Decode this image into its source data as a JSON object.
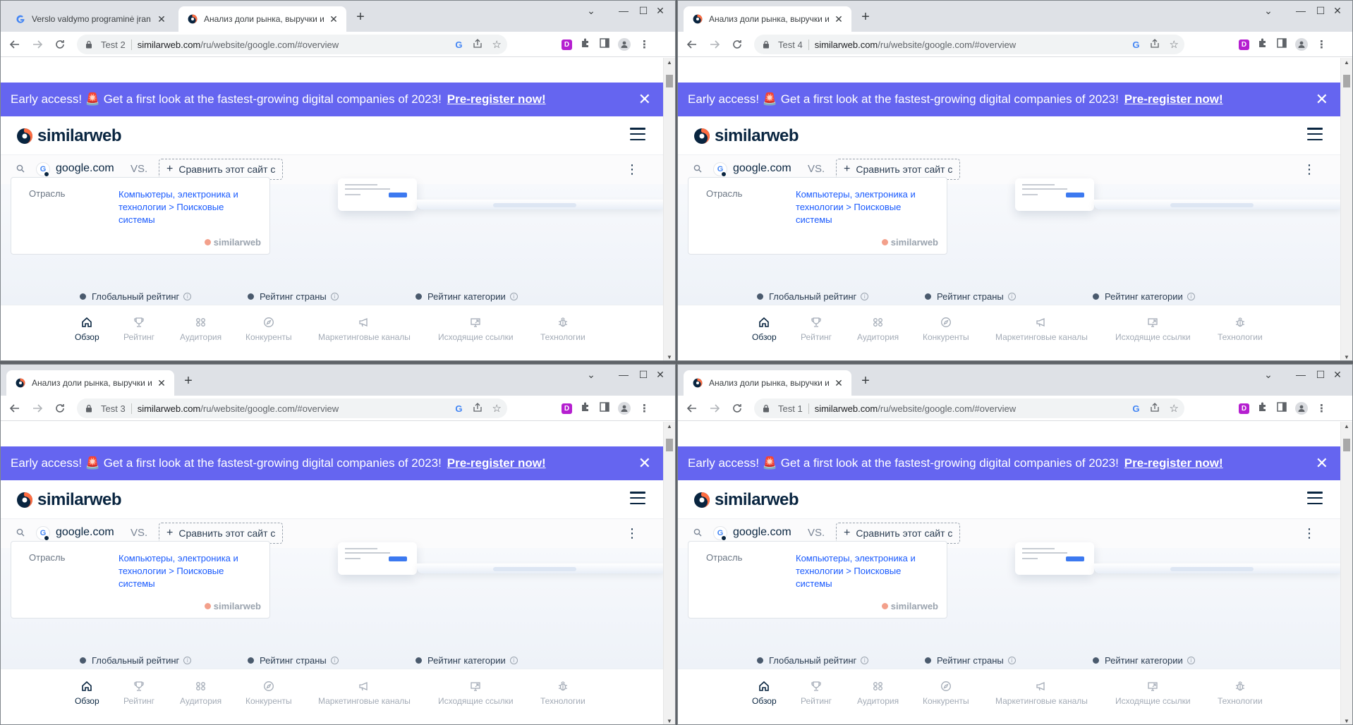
{
  "windows": [
    {
      "tabs": [
        {
          "label": "Verslo valdymo programinė įran",
          "favicon": "google-icon",
          "active": false
        },
        {
          "label": "Анализ доли рынка, выручки и",
          "favicon": "similarweb-icon",
          "active": true
        }
      ],
      "profile": "Test 2",
      "url_domain": "similarweb.com",
      "url_path": "/ru/website/google.com/#overview"
    },
    {
      "tabs": [
        {
          "label": "Анализ доли рынка, выручки и",
          "favicon": "similarweb-icon",
          "active": true
        }
      ],
      "profile": "Test 4",
      "url_domain": "similarweb.com",
      "url_path": "/ru/website/google.com/#overview"
    },
    {
      "tabs": [
        {
          "label": "Анализ доли рынка, выручки и",
          "favicon": "similarweb-icon",
          "active": true
        }
      ],
      "profile": "Test 3",
      "url_domain": "similarweb.com",
      "url_path": "/ru/website/google.com/#overview"
    },
    {
      "tabs": [
        {
          "label": "Анализ доли рынка, выручки и",
          "favicon": "similarweb-icon",
          "active": true
        }
      ],
      "profile": "Test 1",
      "url_domain": "similarweb.com",
      "url_path": "/ru/website/google.com/#overview"
    }
  ],
  "page": {
    "banner": {
      "text": "Early access! 🚨 Get a first look at the fastest-growing digital companies of 2023!",
      "cta": "Pre-register now!",
      "close": "✕"
    },
    "logo": "similarweb",
    "search": {
      "site": "google.com",
      "site_icon_letter": "G",
      "vs": "VS.",
      "compare_label": "Сравнить этот сайт с"
    },
    "industry": {
      "label": "Отрасль",
      "value": "Компьютеры, электроника и технологии > Поисковые системы"
    },
    "watermark": "similarweb",
    "ranks": [
      "Глобальный рейтинг",
      "Рейтинг страны",
      "Рейтинг категории"
    ],
    "nav": [
      {
        "label": "Обзор",
        "icon": "home-icon",
        "active": true
      },
      {
        "label": "Рейтинг",
        "icon": "trophy-icon",
        "active": false
      },
      {
        "label": "Аудитория",
        "icon": "audience-icon",
        "active": false
      },
      {
        "label": "Конкуренты",
        "icon": "compass-icon",
        "active": false
      },
      {
        "label": "Маркетинговые каналы",
        "icon": "megaphone-icon",
        "active": false
      },
      {
        "label": "Исходящие ссылки",
        "icon": "outgoing-links-icon",
        "active": false
      },
      {
        "label": "Технологии",
        "icon": "bug-icon",
        "active": false
      }
    ]
  },
  "colors": {
    "banner": "#6565f0",
    "brand_navy": "#092540",
    "link_blue": "#195afe",
    "chrome_tabstrip": "#dee1e6"
  }
}
